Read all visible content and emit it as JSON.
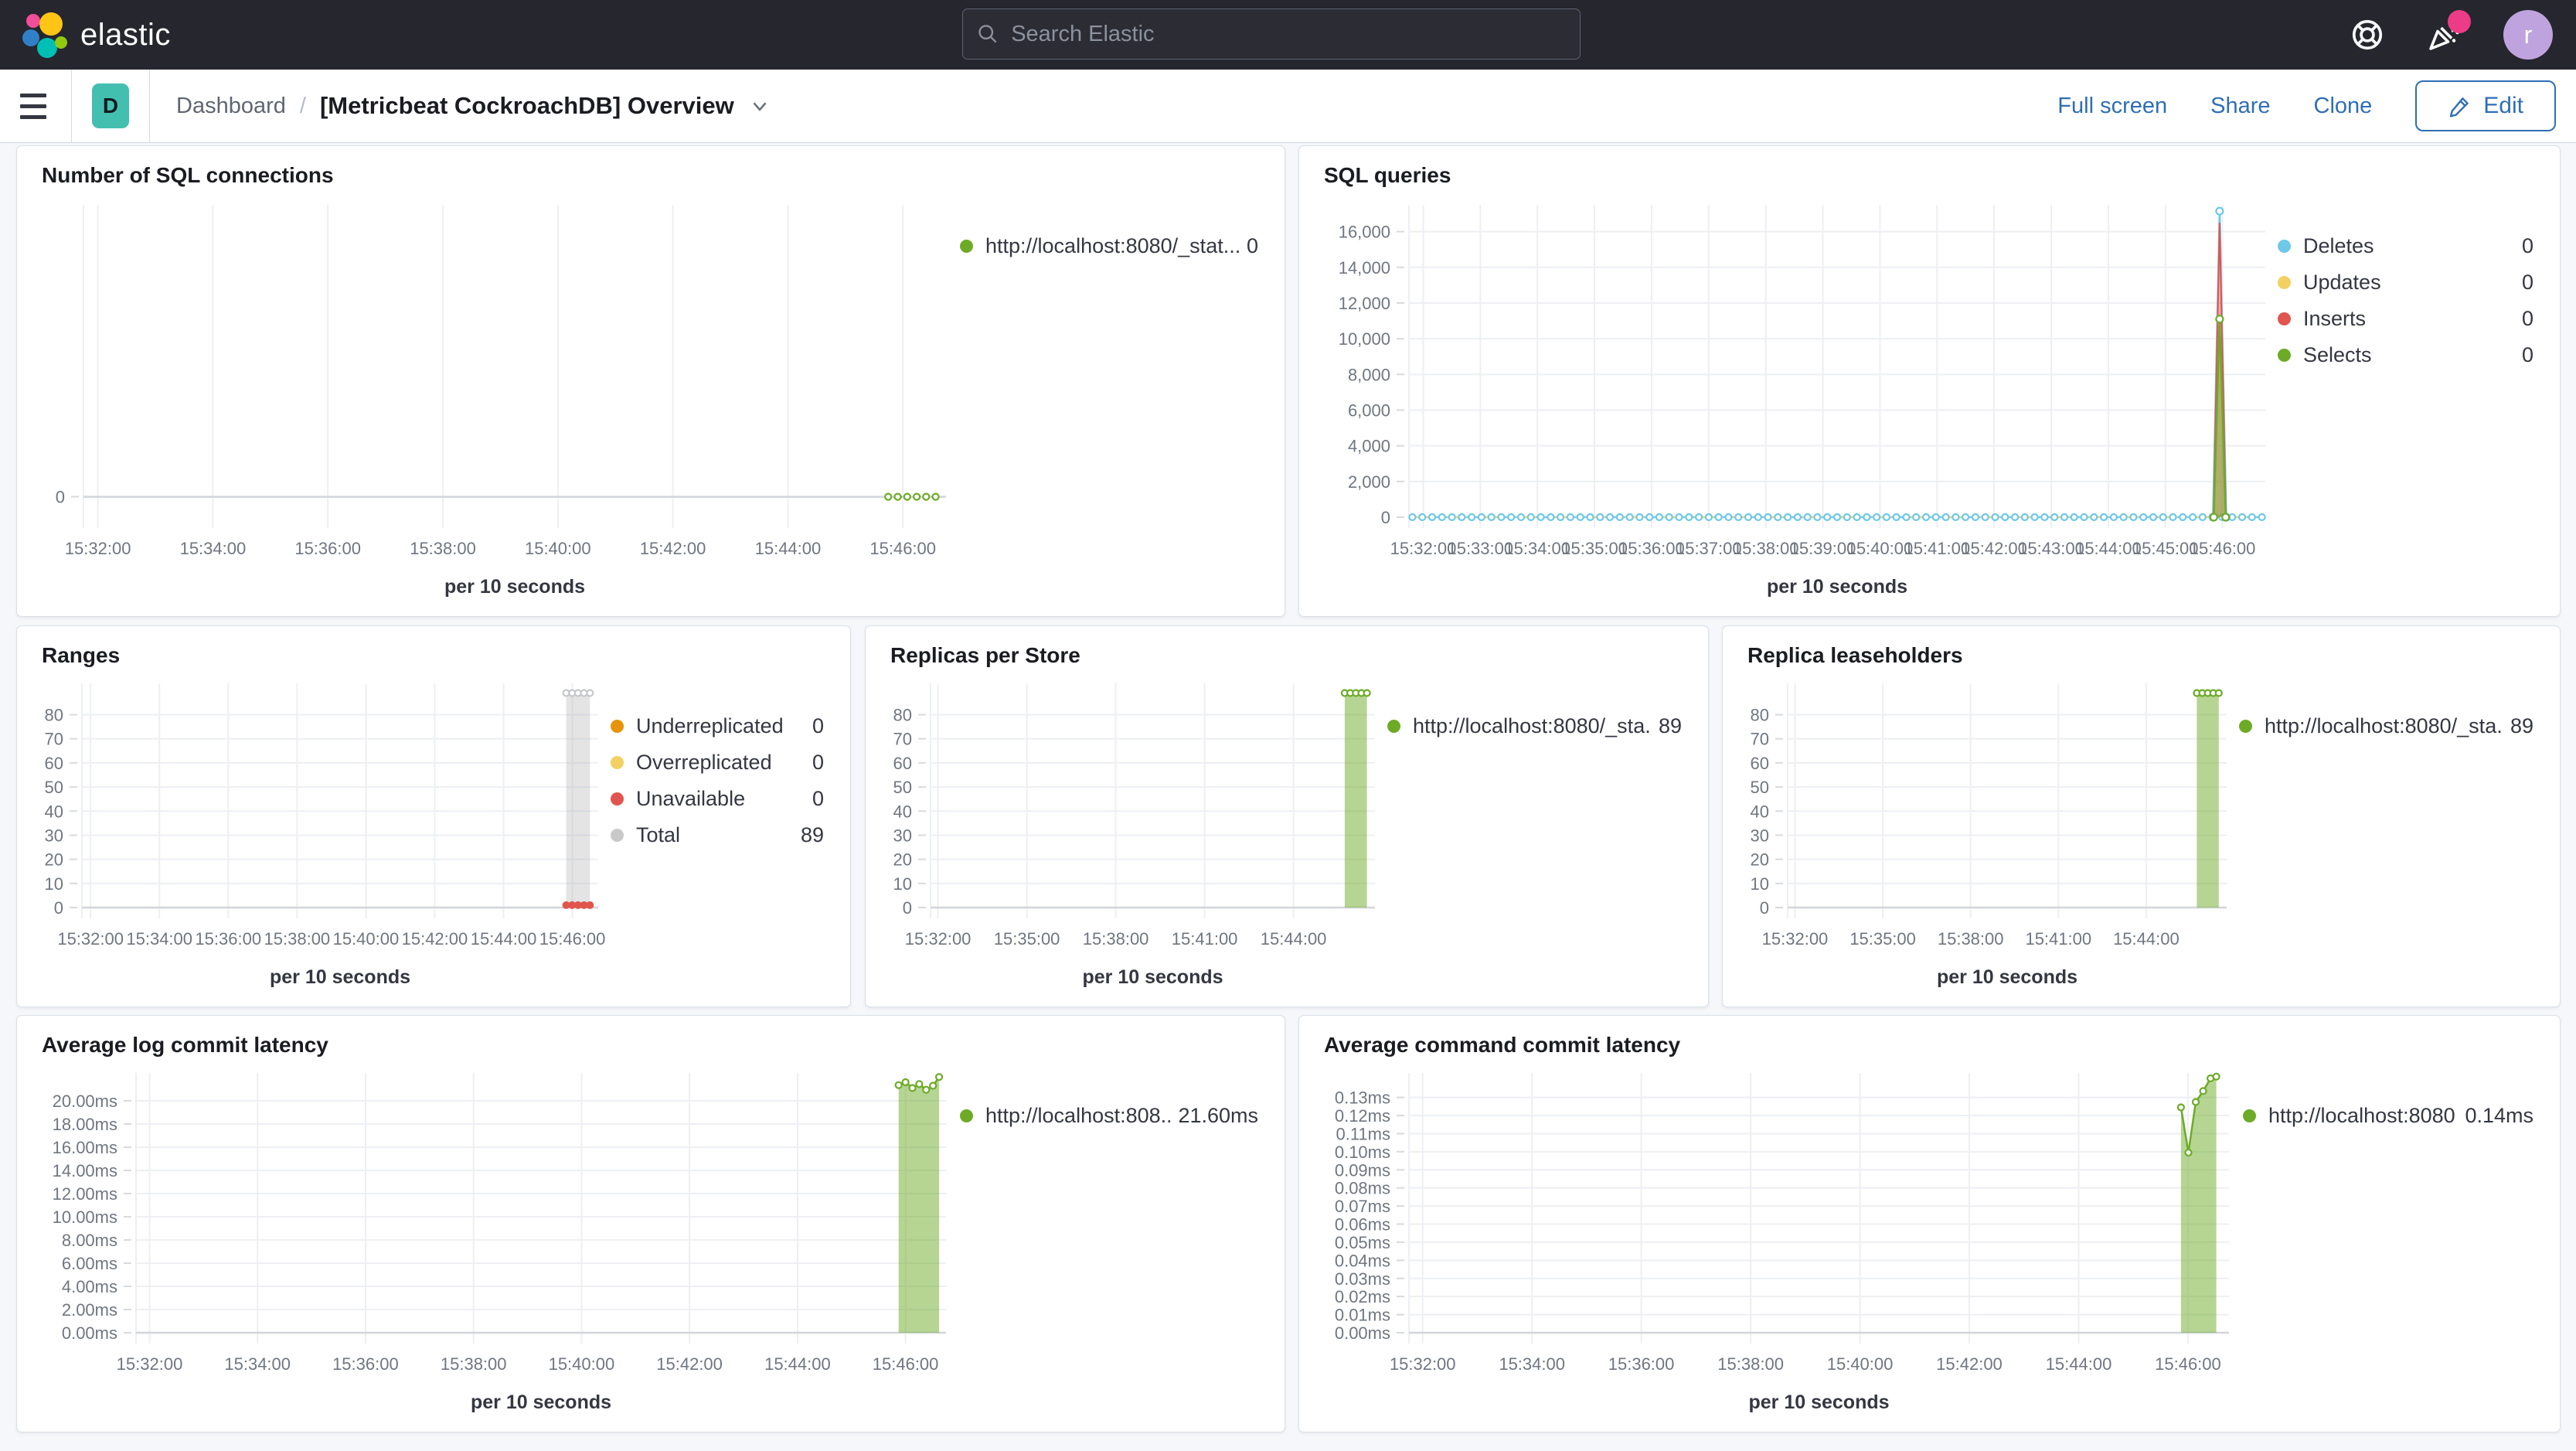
{
  "header": {
    "logo_text": "elastic",
    "search_placeholder": "Search Elastic",
    "avatar_letter": "r",
    "notification_color": "#ed3c87"
  },
  "toolbar": {
    "app_badge": "D",
    "breadcrumb_root": "Dashboard",
    "breadcrumb_sep": "/",
    "title": "[Metricbeat CockroachDB] Overview",
    "full_screen_label": "Full screen",
    "share_label": "Share",
    "clone_label": "Clone",
    "edit_label": "Edit"
  },
  "colors": {
    "green": "#6dab27",
    "blue": "#6fc8e9",
    "yellow": "#f2d162",
    "red": "#e0554d",
    "orange": "#e8930c",
    "gray": "#c9c9c9",
    "link_blue": "#2f6eb5"
  },
  "shared_ticks": {
    "two_min": [
      {
        "label": "15:32:00",
        "f": 0.0167
      },
      {
        "label": "15:34:00",
        "f": 0.15
      },
      {
        "label": "15:36:00",
        "f": 0.2833
      },
      {
        "label": "15:38:00",
        "f": 0.4167
      },
      {
        "label": "15:40:00",
        "f": 0.55
      },
      {
        "label": "15:42:00",
        "f": 0.6833
      },
      {
        "label": "15:44:00",
        "f": 0.8167
      },
      {
        "label": "15:46:00",
        "f": 0.95
      }
    ],
    "one_min": [
      {
        "label": "15:32:00",
        "f": 0.0167
      },
      {
        "label": "15:33:00",
        "f": 0.0833
      },
      {
        "label": "15:34:00",
        "f": 0.15
      },
      {
        "label": "15:35:00",
        "f": 0.2167
      },
      {
        "label": "15:36:00",
        "f": 0.2833
      },
      {
        "label": "15:37:00",
        "f": 0.35
      },
      {
        "label": "15:38:00",
        "f": 0.4167
      },
      {
        "label": "15:39:00",
        "f": 0.4833
      },
      {
        "label": "15:40:00",
        "f": 0.55
      },
      {
        "label": "15:41:00",
        "f": 0.6167
      },
      {
        "label": "15:42:00",
        "f": 0.6833
      },
      {
        "label": "15:43:00",
        "f": 0.75
      },
      {
        "label": "15:44:00",
        "f": 0.8167
      },
      {
        "label": "15:45:00",
        "f": 0.8833
      },
      {
        "label": "15:46:00",
        "f": 0.95
      }
    ],
    "three_min": [
      {
        "label": "15:32:00",
        "f": 0.0167
      },
      {
        "label": "15:35:00",
        "f": 0.2167
      },
      {
        "label": "15:38:00",
        "f": 0.4167
      },
      {
        "label": "15:41:00",
        "f": 0.6167
      },
      {
        "label": "15:44:00",
        "f": 0.8167
      }
    ]
  },
  "panels": [
    {
      "title": "Number of SQL connections",
      "legend": [
        {
          "color": "#6dab27",
          "label": "http://localhost:8080/_stat...",
          "value": "0"
        }
      ],
      "chart_data": {
        "type": "line",
        "x_title": "per 10 seconds",
        "x_ticks": "two_min",
        "y_axis": {
          "min": -0.7,
          "max": 10,
          "ticks": [
            {
              "label": "0",
              "v": 0
            }
          ]
        },
        "layout": {
          "ml": 66,
          "mr": 18,
          "mt": 20,
          "mb": 112
        },
        "series": [
          {
            "name": "sql-connections",
            "stroke": "#6dab27",
            "w": 2,
            "dash": "2 6",
            "marker": "open",
            "r": 4,
            "points": [
              [
                0.933,
                0
              ],
              [
                0.944,
                0
              ],
              [
                0.955,
                0
              ],
              [
                0.966,
                0
              ],
              [
                0.977,
                0
              ],
              [
                0.988,
                0
              ]
            ]
          }
        ]
      }
    },
    {
      "title": "SQL queries",
      "legend": [
        {
          "color": "#6fc8e9",
          "label": "Deletes",
          "value": "0"
        },
        {
          "color": "#f2d162",
          "label": "Updates",
          "value": "0"
        },
        {
          "color": "#e0554d",
          "label": "Inserts",
          "value": "0"
        },
        {
          "color": "#6dab27",
          "label": "Selects",
          "value": "0"
        }
      ],
      "chart_data": {
        "type": "line",
        "x_title": "per 10 seconds",
        "x_ticks": "one_min",
        "y_axis": {
          "min": 0,
          "max": 17500,
          "ticks": [
            {
              "label": "0",
              "v": 0
            },
            {
              "label": "2,000",
              "v": 2000
            },
            {
              "label": "4,000",
              "v": 4000
            },
            {
              "label": "6,000",
              "v": 6000
            },
            {
              "label": "8,000",
              "v": 8000
            },
            {
              "label": "10,000",
              "v": 10000
            },
            {
              "label": "12,000",
              "v": 12000
            },
            {
              "label": "14,000",
              "v": 14000
            },
            {
              "label": "16,000",
              "v": 16000
            }
          ]
        },
        "layout": {
          "ml": 122,
          "mr": 16,
          "mt": 20,
          "mb": 112,
          "xfs": 20
        },
        "series": [
          {
            "name": "updates",
            "stroke": "#f2d162",
            "w": 2,
            "flat": {
              "y": 0,
              "f0": 0.004,
              "f1": 0.996,
              "n": 1
            }
          },
          {
            "name": "deletes",
            "stroke": "#6fc8e9",
            "w": 2,
            "dash": "5 5",
            "marker": "open",
            "r": 4,
            "flat": {
              "y": 0,
              "f0": 0.004,
              "f1": 0.996,
              "n": 86
            }
          },
          {
            "name": "deletes-spike",
            "stroke": "#6fc8e9",
            "w": 2.5,
            "marker": "open",
            "r": 4.5,
            "points": [
              [
                0.9389,
                0
              ],
              [
                0.9467,
                17150
              ],
              [
                0.9544,
                0
              ]
            ]
          },
          {
            "name": "inserts-spike",
            "stroke": "#e0554d",
            "w": 2,
            "fill": "rgba(224,85,77,0.45)",
            "points": [
              [
                0.9395,
                0
              ],
              [
                0.9467,
                16500
              ],
              [
                0.954,
                0
              ]
            ]
          },
          {
            "name": "selects-spike",
            "stroke": "#6dab27",
            "w": 2.5,
            "fill": "rgba(109,171,39,0.5)",
            "marker": "open",
            "r": 4.5,
            "points": [
              [
                0.9398,
                0
              ],
              [
                0.9467,
                11100
              ],
              [
                0.9537,
                0
              ]
            ]
          }
        ]
      }
    },
    {
      "title": "Ranges",
      "legend": [
        {
          "color": "#e8930c",
          "label": "Underreplicated",
          "value": "0"
        },
        {
          "color": "#f2d162",
          "label": "Overreplicated",
          "value": "0"
        },
        {
          "color": "#e0554d",
          "label": "Unavailable",
          "value": "0"
        },
        {
          "color": "#c9c9c9",
          "label": "Total",
          "value": "89"
        }
      ],
      "chart_data": {
        "type": "area",
        "x_title": "per 10 seconds",
        "x_ticks": "two_min",
        "y_axis": {
          "min": 0,
          "max": 93,
          "ticks": [
            {
              "label": "0",
              "v": 0
            },
            {
              "label": "10",
              "v": 10
            },
            {
              "label": "20",
              "v": 20
            },
            {
              "label": "30",
              "v": 30
            },
            {
              "label": "40",
              "v": 40
            },
            {
              "label": "50",
              "v": 50
            },
            {
              "label": "60",
              "v": 60
            },
            {
              "label": "70",
              "v": 70
            },
            {
              "label": "80",
              "v": 80
            }
          ]
        },
        "layout": {
          "ml": 64,
          "mr": 16,
          "mt": 18,
          "mb": 112
        },
        "series": [
          {
            "name": "total",
            "stroke": "#dcdcdc",
            "w": 2,
            "fill": "rgba(170,170,170,0.32)",
            "marker": "open",
            "r": 4,
            "mstroke": "#c4c8cd",
            "points": [
              [
                0.938,
                89
              ],
              [
                0.9495,
                89
              ],
              [
                0.961,
                89
              ],
              [
                0.9725,
                89
              ],
              [
                0.984,
                89
              ]
            ]
          },
          {
            "name": "unavailable",
            "marker": "dot",
            "r": 5,
            "mcolor": "#e0554d",
            "points": [
              [
                0.938,
                1
              ],
              [
                0.9495,
                1
              ],
              [
                0.961,
                1
              ],
              [
                0.9725,
                1
              ],
              [
                0.984,
                1
              ]
            ]
          }
        ]
      }
    },
    {
      "title": "Replicas per Store",
      "legend": [
        {
          "color": "#6dab27",
          "label": "http://localhost:8080/_sta...",
          "value": "89"
        }
      ],
      "chart_data": {
        "type": "area",
        "x_title": "per 10 seconds",
        "x_ticks": "three_min",
        "y_axis": {
          "min": 0,
          "max": 93,
          "ticks": [
            {
              "label": "0",
              "v": 0
            },
            {
              "label": "10",
              "v": 10
            },
            {
              "label": "20",
              "v": 20
            },
            {
              "label": "30",
              "v": 30
            },
            {
              "label": "40",
              "v": 40
            },
            {
              "label": "50",
              "v": 50
            },
            {
              "label": "60",
              "v": 60
            },
            {
              "label": "70",
              "v": 70
            },
            {
              "label": "80",
              "v": 80
            }
          ]
        },
        "layout": {
          "ml": 64,
          "mr": 16,
          "mt": 18,
          "mb": 112
        },
        "series": [
          {
            "name": "replicas",
            "stroke": "#6dab27",
            "w": 2,
            "fill": "rgba(109,171,39,0.5)",
            "marker": "open",
            "r": 4,
            "points": [
              [
                0.932,
                89
              ],
              [
                0.9445,
                89
              ],
              [
                0.957,
                89
              ],
              [
                0.9695,
                89
              ],
              [
                0.982,
                89
              ]
            ]
          }
        ]
      }
    },
    {
      "title": "Replica leaseholders",
      "legend": [
        {
          "color": "#6dab27",
          "label": "http://localhost:8080/_sta...",
          "value": "89"
        }
      ],
      "chart_data": {
        "type": "area",
        "x_title": "per 10 seconds",
        "x_ticks": "three_min",
        "y_axis": {
          "min": 0,
          "max": 93,
          "ticks": [
            {
              "label": "0",
              "v": 0
            },
            {
              "label": "10",
              "v": 10
            },
            {
              "label": "20",
              "v": 20
            },
            {
              "label": "30",
              "v": 30
            },
            {
              "label": "40",
              "v": 40
            },
            {
              "label": "50",
              "v": 50
            },
            {
              "label": "60",
              "v": 60
            },
            {
              "label": "70",
              "v": 70
            },
            {
              "label": "80",
              "v": 80
            }
          ]
        },
        "layout": {
          "ml": 64,
          "mr": 16,
          "mt": 18,
          "mb": 112
        },
        "series": [
          {
            "name": "leaseholders",
            "stroke": "#6dab27",
            "w": 2,
            "fill": "rgba(109,171,39,0.5)",
            "marker": "open",
            "r": 4,
            "points": [
              [
                0.932,
                89
              ],
              [
                0.9445,
                89
              ],
              [
                0.957,
                89
              ],
              [
                0.9695,
                89
              ],
              [
                0.982,
                89
              ]
            ]
          }
        ]
      }
    },
    {
      "title": "Average log commit latency",
      "legend": [
        {
          "color": "#6dab27",
          "label": "http://localhost:808...",
          "value": "21.60ms"
        }
      ],
      "chart_data": {
        "type": "area",
        "x_title": "per 10 seconds",
        "x_ticks": "two_min",
        "y_axis": {
          "min": 0,
          "max": 22.4,
          "ticks": [
            {
              "label": "0.00ms",
              "v": 0
            },
            {
              "label": "2.00ms",
              "v": 2
            },
            {
              "label": "4.00ms",
              "v": 4
            },
            {
              "label": "6.00ms",
              "v": 6
            },
            {
              "label": "8.00ms",
              "v": 8
            },
            {
              "label": "10.00ms",
              "v": 10
            },
            {
              "label": "12.00ms",
              "v": 12
            },
            {
              "label": "14.00ms",
              "v": 14
            },
            {
              "label": "16.00ms",
              "v": 16
            },
            {
              "label": "18.00ms",
              "v": 18
            },
            {
              "label": "20.00ms",
              "v": 20
            }
          ]
        },
        "layout": {
          "ml": 134,
          "mr": 18,
          "mt": 18,
          "mb": 112
        },
        "series": [
          {
            "name": "log-commit-latency",
            "stroke": "#6dab27",
            "w": 2.5,
            "fill": "rgba(109,171,39,0.5)",
            "marker": "open",
            "r": 4,
            "points": [
              [
                0.9415,
                21.35
              ],
              [
                0.95,
                21.6
              ],
              [
                0.9585,
                21.1
              ],
              [
                0.967,
                21.45
              ],
              [
                0.9755,
                20.95
              ],
              [
                0.984,
                21.3
              ],
              [
                0.9915,
                22.05
              ]
            ]
          }
        ]
      }
    },
    {
      "title": "Average command commit latency",
      "legend": [
        {
          "color": "#6dab27",
          "label": "http://localhost:8080...",
          "value": "0.14ms"
        }
      ],
      "chart_data": {
        "type": "area",
        "x_title": "per 10 seconds",
        "x_ticks": "two_min",
        "y_axis": {
          "min": 0,
          "max": 0.1435,
          "ticks": [
            {
              "label": "0.00ms",
              "v": 0
            },
            {
              "label": "0.01ms",
              "v": 0.01
            },
            {
              "label": "0.02ms",
              "v": 0.02
            },
            {
              "label": "0.03ms",
              "v": 0.03
            },
            {
              "label": "0.04ms",
              "v": 0.04
            },
            {
              "label": "0.05ms",
              "v": 0.05
            },
            {
              "label": "0.06ms",
              "v": 0.06
            },
            {
              "label": "0.07ms",
              "v": 0.07
            },
            {
              "label": "0.08ms",
              "v": 0.08
            },
            {
              "label": "0.09ms",
              "v": 0.09
            },
            {
              "label": "0.10ms",
              "v": 0.1
            },
            {
              "label": "0.11ms",
              "v": 0.11
            },
            {
              "label": "0.12ms",
              "v": 0.12
            },
            {
              "label": "0.13ms",
              "v": 0.13
            }
          ]
        },
        "layout": {
          "ml": 122,
          "mr": 18,
          "mt": 18,
          "mb": 112
        },
        "series": [
          {
            "name": "command-commit-latency",
            "stroke": "#6dab27",
            "w": 2.5,
            "fill": "rgba(109,171,39,0.5)",
            "marker": "open",
            "r": 4,
            "points": [
              [
                0.9415,
                0.1245
              ],
              [
                0.9505,
                0.0995
              ],
              [
                0.9595,
                0.1275
              ],
              [
                0.9685,
                0.1335
              ],
              [
                0.9775,
                0.1405
              ],
              [
                0.9845,
                0.1415
              ]
            ]
          }
        ]
      }
    }
  ]
}
